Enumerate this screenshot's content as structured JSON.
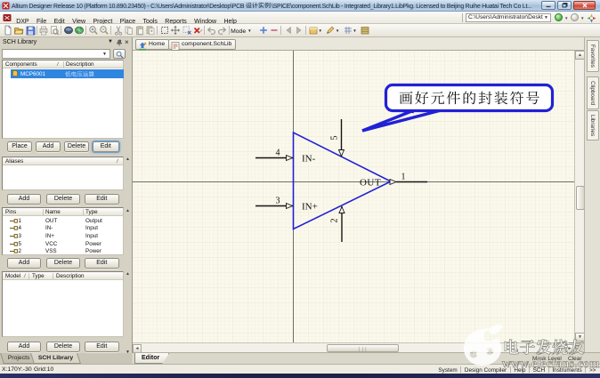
{
  "window": {
    "title_prefix": "Altium Designer Release 10 (Platform 10.890.23450) - C:\\Users\\Administrator\\Desktop\\PCB ",
    "title_cjk": "设计实例",
    "title_suffix": "\\SPICE\\component.SchLib - Integrated_Library1.LibPkg. Licensed to Beijing Ruihe Huatai Tech Co Lt...",
    "controls": {
      "minimize": "minimize",
      "restore": "restore",
      "close": "close"
    }
  },
  "menu_bar": {
    "items": [
      "DXP",
      "File",
      "Edit",
      "View",
      "Project",
      "Place",
      "Tools",
      "Reports",
      "Window",
      "Help"
    ],
    "address": {
      "value": "C:\\Users\\Administrator\\Deskt"
    }
  },
  "toolbar": {
    "mode_label": "Mode",
    "icons": [
      "new-document",
      "open-document",
      "save",
      "print",
      "print-preview",
      "view-3d",
      "view-board",
      "zoom-in",
      "zoom-out",
      "cut",
      "copy",
      "paste",
      "paste-array",
      "select-area",
      "move-selection",
      "deselect-all",
      "clear-filter",
      "undo",
      "redo",
      "zoom-plus",
      "zoom-minus",
      "previous-view",
      "next-view",
      "vault",
      "annotate",
      "grids",
      "storage-manager"
    ]
  },
  "sch_library_panel": {
    "title": "SCH Library",
    "search": {
      "value": ""
    },
    "components": {
      "columns": [
        "Components",
        "Description"
      ],
      "sort_indicator": "/",
      "rows": [
        {
          "name": "MCP6001",
          "description": "低电压运算",
          "selected": true
        }
      ],
      "buttons": [
        "Place",
        "Add",
        "Delete",
        "Edit"
      ]
    },
    "aliases": {
      "title": "Aliases",
      "sort_indicator": "/",
      "rows": [],
      "buttons": [
        "Add",
        "Delete",
        "Edit"
      ]
    },
    "pins": {
      "columns": [
        "Pins",
        "Name",
        "Type"
      ],
      "rows": [
        {
          "designator": "1",
          "name": "OUT",
          "type": "Output"
        },
        {
          "designator": "4",
          "name": "IN-",
          "type": "Input"
        },
        {
          "designator": "3",
          "name": "IN+",
          "type": "Input"
        },
        {
          "designator": "5",
          "name": "VCC",
          "type": "Power"
        },
        {
          "designator": "2",
          "name": "VSS",
          "type": "Power"
        }
      ],
      "buttons": [
        "Add",
        "Delete",
        "Edit"
      ]
    },
    "model": {
      "columns": [
        "Model",
        "Type",
        "Description"
      ],
      "sort_indicator": "/",
      "rows": [],
      "buttons": [
        "Add",
        "Delete",
        "Edit"
      ]
    },
    "bottom_tabs": [
      {
        "label": "Projects",
        "active": false
      },
      {
        "label": "SCH Library",
        "active": true
      }
    ]
  },
  "document_bar": {
    "tabs": [
      {
        "label": "Home"
      },
      {
        "label": "component.SchLib"
      }
    ]
  },
  "right_panel_tabs": [
    "Favorites",
    "Clipboard",
    "Libraries"
  ],
  "editor": {
    "tab_label": "Editor",
    "mask_level_label": "Mask Level",
    "clear_label": "Clear",
    "callout_text": "画好元件的封装符号",
    "component": {
      "labels": {
        "in_minus": "IN-",
        "in_plus": "IN+",
        "out": "OUT"
      },
      "pin_numbers": {
        "p1": "1",
        "p2": "2",
        "p3": "3",
        "p4": "4",
        "p5": "5"
      }
    }
  },
  "status_bar": {
    "position": "X:170Y:-30",
    "grid": "Grid:10",
    "right_items": [
      "System",
      "Design Compiler",
      "Help",
      "SCH",
      "Instruments",
      ">>"
    ]
  },
  "watermark": {
    "brand": "电子发烧友",
    "url": "www.elecfans.com"
  }
}
